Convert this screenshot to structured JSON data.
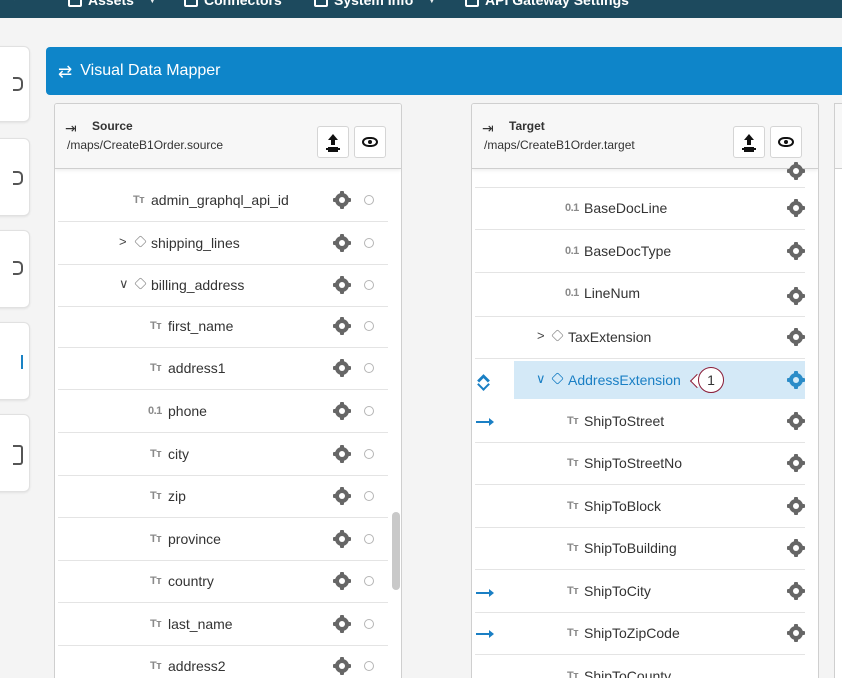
{
  "topnav": {
    "items": [
      {
        "label": "Assets",
        "icon": "grid-icon"
      },
      {
        "label": "Connectors",
        "icon": "plug-icon"
      },
      {
        "label": "System Info",
        "icon": "monitor-icon"
      },
      {
        "label": "API Gateway Settings",
        "icon": "window-icon"
      }
    ]
  },
  "mapper": {
    "title": "Visual Data Mapper",
    "icon": "swap-arrows-icon"
  },
  "source": {
    "title": "Source",
    "path": "/maps/CreateB1Order.source",
    "rows": [
      {
        "type_icon": "Tт",
        "label": "admin_graphql_api_id"
      },
      {
        "type_icon": "",
        "label": "shipping_lines",
        "chevron": ">"
      },
      {
        "type_icon": "",
        "label": "billing_address",
        "chevron": "∨"
      },
      {
        "type_icon": "Tт",
        "label": "first_name"
      },
      {
        "type_icon": "Tт",
        "label": "address1"
      },
      {
        "type_icon": "0.1",
        "label": "phone"
      },
      {
        "type_icon": "Tт",
        "label": "city"
      },
      {
        "type_icon": "Tт",
        "label": "zip"
      },
      {
        "type_icon": "Tт",
        "label": "province"
      },
      {
        "type_icon": "Tт",
        "label": "country"
      },
      {
        "type_icon": "Tт",
        "label": "last_name"
      },
      {
        "type_icon": "Tт",
        "label": "address2"
      }
    ]
  },
  "target": {
    "title": "Target",
    "path": "/maps/CreateB1Order.target",
    "rows": [
      {
        "type_icon": "0.1",
        "label": "BaseDocLine"
      },
      {
        "type_icon": "0.1",
        "label": "BaseDocType"
      },
      {
        "type_icon": "0.1",
        "label": "LineNum"
      },
      {
        "type_icon": "",
        "label": "TaxExtension",
        "chevron": ">"
      },
      {
        "type_icon": "",
        "label": "AddressExtension",
        "chevron": "∨",
        "selected": true
      },
      {
        "type_icon": "Tт",
        "label": "ShipToStreet",
        "mapped": true
      },
      {
        "type_icon": "Tт",
        "label": "ShipToStreetNo"
      },
      {
        "type_icon": "Tт",
        "label": "ShipToBlock"
      },
      {
        "type_icon": "Tт",
        "label": "ShipToBuilding"
      },
      {
        "type_icon": "Tт",
        "label": "ShipToCity",
        "mapped": true
      },
      {
        "type_icon": "Tт",
        "label": "ShipToZipCode",
        "mapped": true
      },
      {
        "type_icon": "Tт",
        "label": "ShipToCounty"
      }
    ]
  },
  "callout": {
    "number": "1"
  },
  "colors": {
    "accent": "#0e85c9",
    "nav": "#1d4a5e",
    "selected": "#d4e9f7",
    "callout_border": "#8b1d38"
  }
}
